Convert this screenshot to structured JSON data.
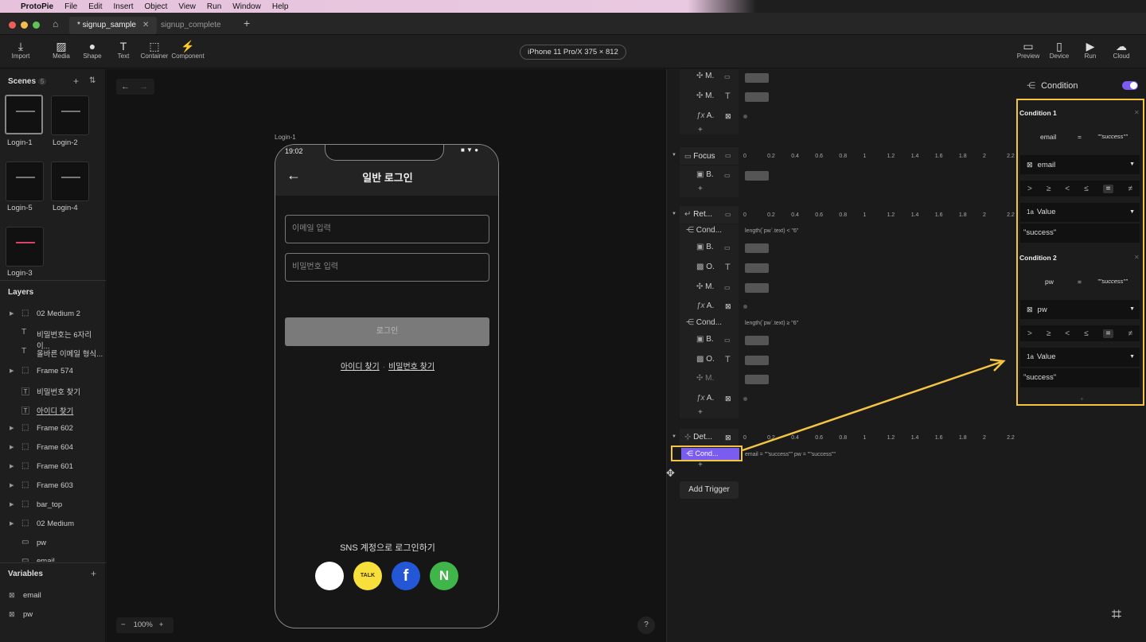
{
  "menubar": {
    "app": "ProtoPie",
    "items": [
      "File",
      "Edit",
      "Insert",
      "Object",
      "View",
      "Run",
      "Window",
      "Help"
    ]
  },
  "tabs": [
    {
      "label": "* signup_sample"
    },
    {
      "label": "signup_complete"
    }
  ],
  "toolbar": {
    "import": "Import",
    "media": "Media",
    "shape": "Shape",
    "text": "Text",
    "container": "Container",
    "component": "Component",
    "device": "iPhone 11 Pro/X  375 × 812",
    "preview": "Preview",
    "device_btn": "Device",
    "run": "Run",
    "cloud": "Cloud"
  },
  "scenes": {
    "title": "Scenes",
    "count": "5",
    "items": [
      "Login-1",
      "Login-2",
      "Login-5",
      "Login-4",
      "Login-3"
    ]
  },
  "layers": {
    "title": "Layers",
    "items": [
      "02 Medium 2",
      "비밀번호는 6자리 이...",
      "올바른 이메일 형식...",
      "Frame 574",
      "비밀번호 찾기",
      "아이디 찾기",
      "Frame 602",
      "Frame 604",
      "Frame 601",
      "Frame 603",
      "bar_top",
      "02 Medium",
      "pw",
      "email"
    ]
  },
  "variables": {
    "title": "Variables",
    "items": [
      "email",
      "pw"
    ]
  },
  "canvas": {
    "scene_label": "Login-1",
    "zoom": "100%",
    "help": "?"
  },
  "phone": {
    "time": "19:02",
    "title": "일반 로그인",
    "email_ph": "이메일 입력",
    "pw_ph": "비밀번호 입력",
    "login": "로그인",
    "find_id": "아이디 찾기",
    "find_pw": "비밀번호 찾기",
    "sns": "SNS 계정으로 로그인하기",
    "talk": "TALK",
    "fb": "f",
    "naver": "N"
  },
  "timeline": {
    "scale": [
      "0",
      "0.2",
      "0.4",
      "0.6",
      "0.8",
      "1",
      "1.2",
      "1.4",
      "1.6",
      "1.8",
      "2",
      "2.2"
    ],
    "rows": {
      "m1": "M.",
      "m2": "M.",
      "a1": "A.",
      "focus": "Focus",
      "b1": "B.",
      "ret": "Ret...",
      "cond1": "Cond...",
      "b2": "B.",
      "o1": "O.",
      "m3": "M.",
      "a2": "A.",
      "cond2": "Cond...",
      "b3": "B.",
      "o2": "O.",
      "m4": "M.",
      "a3": "A.",
      "det": "Det...",
      "cond3": "Cond..."
    },
    "expr1": "length(`pw`.text) < \"6\"",
    "expr2": "length(`pw`.text) ≥ \"6\"",
    "expr3": "email = \"\"success\"\"      pw = \"\"success\"\"",
    "add_trigger": "Add Trigger"
  },
  "properties": {
    "header": "Condition",
    "conditions": [
      {
        "title": "Condition 1",
        "summary_left": "email",
        "summary_op": "=",
        "summary_right": "\"\"success\"\"",
        "variable": "email",
        "value_type": "Value",
        "value": "\"success\""
      },
      {
        "title": "Condition 2",
        "summary_left": "pw",
        "summary_op": "=",
        "summary_right": "\"\"success\"\"",
        "variable": "pw",
        "value_type": "Value",
        "value": "\"success\""
      }
    ],
    "ops": [
      ">",
      "≥",
      "<",
      "≤",
      "=",
      "≠"
    ]
  },
  "colors": {
    "accent": "#7a5cf0",
    "highlight": "#f5c542",
    "kakao": "#f7e03b",
    "facebook": "#2457d6",
    "naver": "#3fb54a"
  }
}
